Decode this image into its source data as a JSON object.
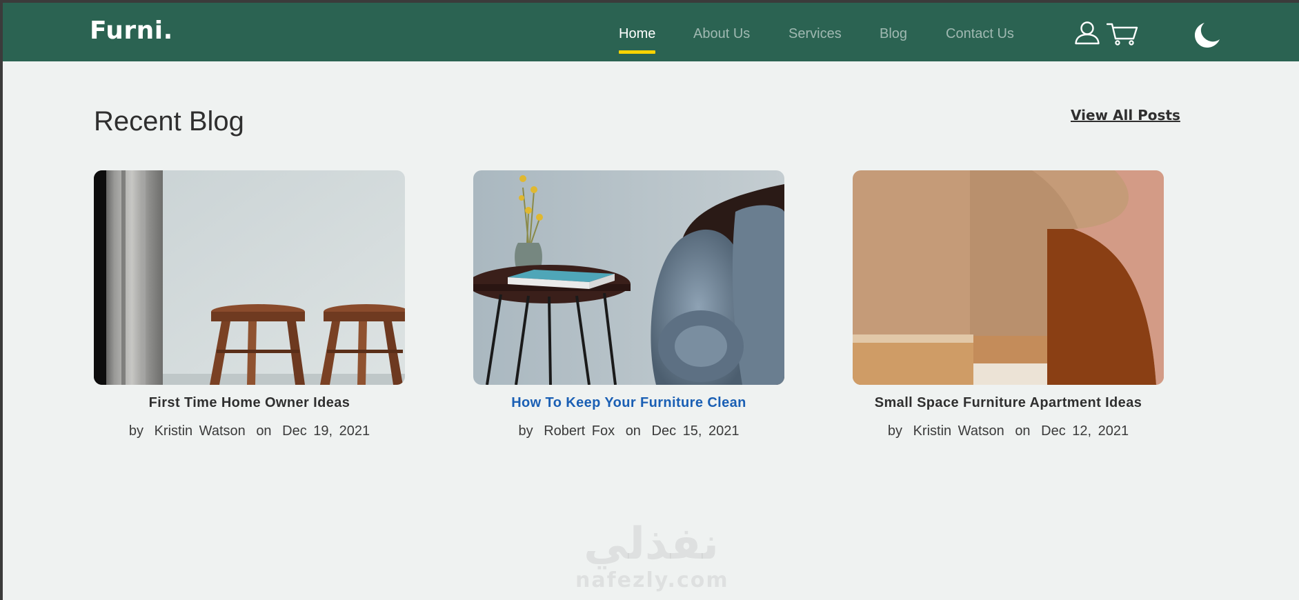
{
  "navbar": {
    "logo": "Furni.",
    "items": [
      {
        "label": "Home",
        "active": true
      },
      {
        "label": "About Us",
        "active": false
      },
      {
        "label": "Services",
        "active": false
      },
      {
        "label": "Blog",
        "active": false
      },
      {
        "label": "Contact Us",
        "active": false
      }
    ],
    "icons": [
      "user-icon",
      "cart-icon",
      "moon-icon"
    ],
    "accent_color": "#f9d300",
    "background_color": "#2b6352"
  },
  "blog": {
    "title": "Recent Blog",
    "view_all_label": "View All Posts",
    "posts": [
      {
        "title": "First Time Home Owner Ideas",
        "by": "by",
        "author": "Kristin Watson",
        "on": "on",
        "date": "Dec 19, 2021",
        "image": "stools-image"
      },
      {
        "title": "How To Keep Your Furniture Clean",
        "by": "by",
        "author": "Robert Fox",
        "on": "on",
        "date": "Dec 15, 2021",
        "image": "side-table-sofa-image"
      },
      {
        "title": "Small Space Furniture Apartment Ideas",
        "by": "by",
        "author": "Kristin Watson",
        "on": "on",
        "date": "Dec 12, 2021",
        "image": "geometric-shapes-image"
      }
    ]
  },
  "watermark": {
    "arabic": "نفذلي",
    "latin": "nafezly.com"
  }
}
